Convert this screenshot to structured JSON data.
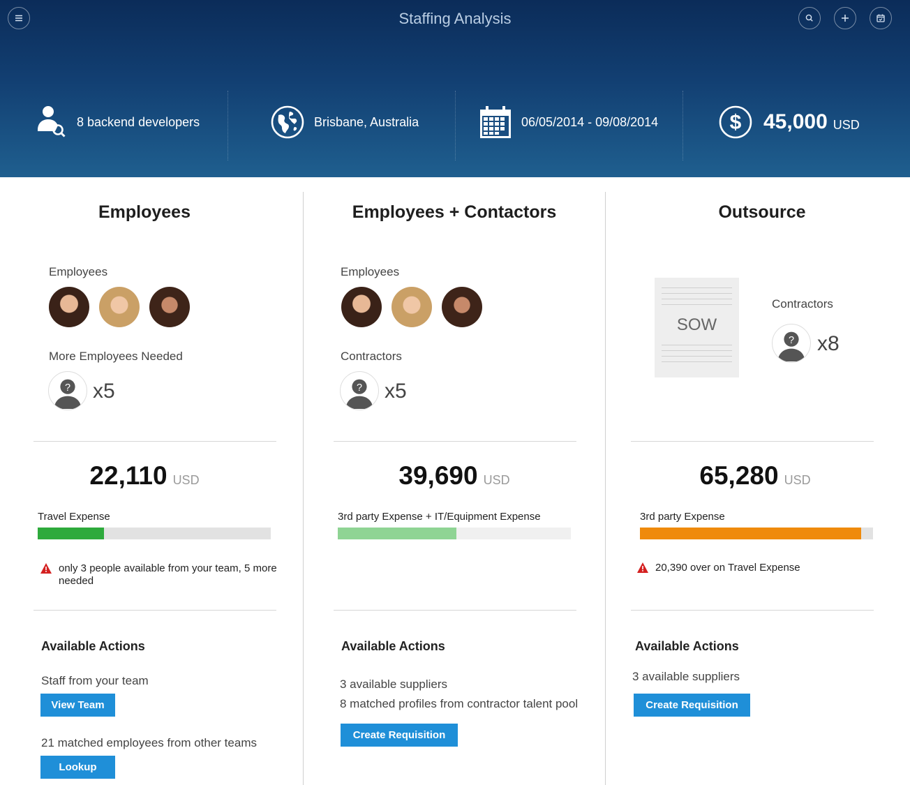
{
  "app": {
    "title": "Staffing Analysis"
  },
  "header_buttons": [
    {
      "name": "menu-icon"
    },
    {
      "name": "search-icon"
    },
    {
      "name": "add-icon"
    },
    {
      "name": "calendar-check-icon"
    }
  ],
  "summary": {
    "developers": "8 backend developers",
    "location": "Brisbane, Australia",
    "dates": "06/05/2014 - 09/08/2014",
    "budget": "45,000",
    "budget_unit": "USD"
  },
  "columns": [
    {
      "title": "Employees",
      "group1_label": "Employees",
      "group2_label": "More Employees Needed",
      "group2_multiplier": "x5",
      "total": "22,110",
      "total_unit": "USD",
      "bar_label": "Travel Expense",
      "bar_fraction": 0.285,
      "bar_color": "#2eaa3c",
      "warning": "only 3 people available from your team, 5 more needed",
      "actions_title": "Available Actions",
      "action1_text": "Staff from your team",
      "action1_button": "View Team",
      "action2_text": "21 matched employees from other teams",
      "action2_button": "Lookup"
    },
    {
      "title": "Employees + Contactors",
      "group1_label": "Employees",
      "group2_label": "Contractors",
      "group2_multiplier": "x5",
      "total": "39,690",
      "total_unit": "USD",
      "bar_label": "3rd party Expense + IT/Equipment Expense",
      "bar_fraction": 0.51,
      "bar_color": "#8fd494",
      "actions_title": "Available Actions",
      "action1_text": "3 available suppliers",
      "action2_text": "8 matched profiles from contractor talent pool",
      "action_button": "Create Requisition"
    },
    {
      "title": "Outsource",
      "sow_label": "SOW",
      "contractors_label": "Contractors",
      "contractors_multiplier": "x8",
      "total": "65,280",
      "total_unit": "USD",
      "bar_label": "3rd party Expense",
      "bar_fraction": 0.95,
      "bar_color": "#ef8a0c",
      "warning": "20,390 over on Travel Expense",
      "actions_title": "Available Actions",
      "action1_text": "3 available suppliers",
      "action_button": "Create Requisition"
    }
  ],
  "colors": {
    "accent": "#1f8fd8",
    "header_top": "#0b2c59",
    "warning": "#d42020"
  }
}
